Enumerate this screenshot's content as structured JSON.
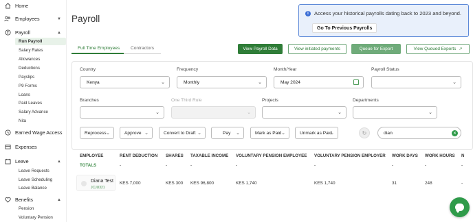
{
  "sidebar": {
    "top_items": [
      {
        "label": "Home",
        "icon": "home-icon"
      },
      {
        "label": "Employees",
        "icon": "users-icon"
      },
      {
        "label": "Payroll",
        "icon": "payroll-icon"
      },
      {
        "label": "Earned Wage Access",
        "icon": "wallet-icon"
      },
      {
        "label": "Expenses",
        "icon": "receipt-icon"
      },
      {
        "label": "Leave",
        "icon": "calendar-icon"
      },
      {
        "label": "Benefits",
        "icon": "heart-icon"
      }
    ],
    "payroll_sub": [
      "Run Payroll",
      "Salary Rates",
      "Allowances",
      "Deductions",
      "Payslips",
      "P9 Forms",
      "Loans",
      "Paid Leaves",
      "Salary Advance",
      "Nita"
    ],
    "leave_sub": [
      "Leave Requests",
      "Leave Scheduling",
      "Leave Balance"
    ],
    "benefits_sub": [
      "Pension",
      "Voluntary Pension"
    ]
  },
  "page": {
    "title": "Payroll"
  },
  "banner": {
    "message": "Access your historical payrolls dating back to 2023 and beyond.",
    "button": "Go To Previous Payrolls"
  },
  "tabs": [
    "Full Time Employees",
    "Contractors"
  ],
  "toolbar": {
    "view_payroll_data": "View Payroll Data",
    "view_initiated_payments": "View initiated payments",
    "queue_for_export": "Queue for Export",
    "view_queued_exports": "View Queued Exports"
  },
  "filters": {
    "country": {
      "label": "Country",
      "value": "Kenya"
    },
    "frequency": {
      "label": "Frequency",
      "value": "Monthly"
    },
    "month_year": {
      "label": "Month/Year",
      "value": "May 2024"
    },
    "payroll_status": {
      "label": "Payroll Status",
      "value": ""
    },
    "branches": {
      "label": "Branches",
      "value": ""
    },
    "one_third_rule": {
      "label": "One Third Rule",
      "value": ""
    },
    "projects": {
      "label": "Projects",
      "value": ""
    },
    "departments": {
      "label": "Departments",
      "value": ""
    }
  },
  "actions": [
    "Reprocess",
    "Approve",
    "Convert to Draft",
    "Pay",
    "Mark as Paid",
    "Unmark as Paid"
  ],
  "search": {
    "value": "dian"
  },
  "table": {
    "headers": [
      "EMPLOYEE",
      "RENT DEDUCTION",
      "SHARES",
      "TAXABLE INCOME",
      "VOLUNTARY PENSION EMPLOYEE",
      "VOLUNTARY PENSION EMPLOYER",
      "WORK DAYS",
      "WORK HOURS",
      "N"
    ],
    "totals": {
      "label": "TOTALS",
      "values": [
        "-",
        "-",
        "-",
        "-",
        "-",
        "-",
        "-",
        "-"
      ]
    },
    "rows": [
      {
        "name": "Diana Test",
        "code": "JCJU321",
        "rent_deduction": "KES 7,000",
        "shares": "KES 300",
        "taxable_income": "KES 96,800",
        "vp_employee": "KES 1,740",
        "vp_employer": "KES 1,740",
        "work_days": "31",
        "work_hours": "248",
        "n": "-"
      }
    ]
  },
  "colors": {
    "brand_green": "#2f7d38",
    "banner_bg": "#e9f0fb",
    "banner_border": "#5d89d8"
  }
}
